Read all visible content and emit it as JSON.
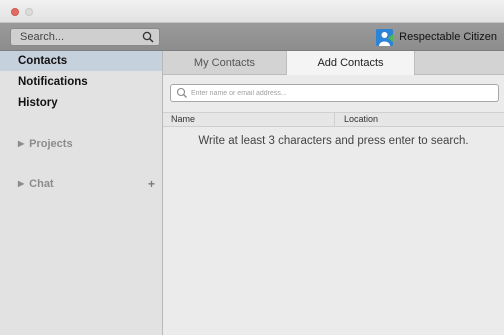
{
  "toolbar": {
    "search_placeholder": "Search...",
    "user_name": "Respectable Citizen"
  },
  "sidebar": {
    "items": [
      {
        "label": "Contacts",
        "active": true
      },
      {
        "label": "Notifications",
        "active": false
      },
      {
        "label": "History",
        "active": false
      }
    ],
    "sections": [
      {
        "label": "Projects"
      },
      {
        "label": "Chat"
      }
    ]
  },
  "tabs": [
    {
      "label": "My Contacts",
      "selected": false
    },
    {
      "label": "Add Contacts",
      "selected": true
    }
  ],
  "contact_search": {
    "placeholder": "Enter name or email address..."
  },
  "table": {
    "columns": [
      "Name",
      "Location"
    ]
  },
  "hint": "Write at least 3 characters and press enter to search.",
  "icons": {
    "search": "magnifier-icon",
    "add": "plus-icon",
    "disclosure": "triangle-right-icon"
  },
  "colors": {
    "selected_sidebar": "#c6d1de",
    "avatar": "#2d83d6",
    "close_button": "#e06c62"
  }
}
